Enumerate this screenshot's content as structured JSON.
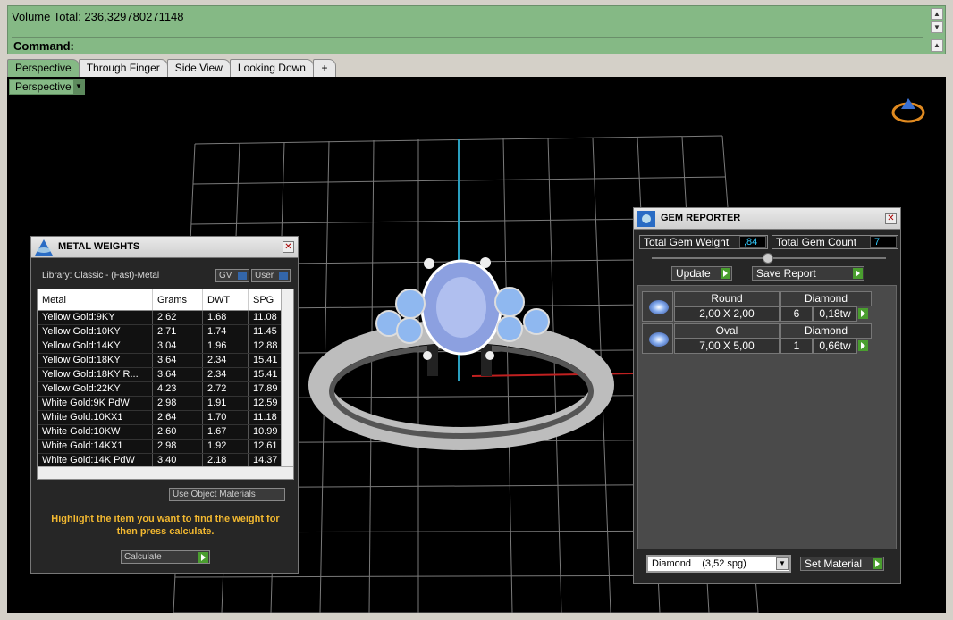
{
  "command_area": {
    "history": "Volume Total: 236,329780271148",
    "command_label": "Command:",
    "command_value": ""
  },
  "tabs": [
    "Perspective",
    "Through Finger",
    "Side View",
    "Looking Down"
  ],
  "tab_add": "+",
  "viewport": {
    "view_selector": "Perspective"
  },
  "metal_weights": {
    "title": "METAL WEIGHTS",
    "library_label": "Library: Classic - (Fast)-Metal",
    "gv_label": "GV",
    "user_label": "User",
    "columns": [
      "Metal",
      "Grams",
      "DWT",
      "SPG"
    ],
    "rows": [
      [
        "Yellow Gold:9KY",
        "2.62",
        "1.68",
        "11.08"
      ],
      [
        "Yellow Gold:10KY",
        "2.71",
        "1.74",
        "11.45"
      ],
      [
        "Yellow Gold:14KY",
        "3.04",
        "1.96",
        "12.88"
      ],
      [
        "Yellow Gold:18KY",
        "3.64",
        "2.34",
        "15.41"
      ],
      [
        "Yellow Gold:18KY R...",
        "3.64",
        "2.34",
        "15.41"
      ],
      [
        "Yellow Gold:22KY",
        "4.23",
        "2.72",
        "17.89"
      ],
      [
        "White Gold:9K PdW",
        "2.98",
        "1.91",
        "12.59"
      ],
      [
        "White Gold:10KX1",
        "2.64",
        "1.70",
        "11.18"
      ],
      [
        "White Gold:10KW",
        "2.60",
        "1.67",
        "10.99"
      ],
      [
        "White Gold:14KX1",
        "2.98",
        "1.92",
        "12.61"
      ],
      [
        "White Gold:14K PdW",
        "3.40",
        "2.18",
        "14.37"
      ]
    ],
    "use_object_materials": "Use Object Materials",
    "instruction": "Highlight the item you want to find the weight for then press calculate.",
    "calculate": "Calculate"
  },
  "gem_reporter": {
    "title": "GEM REPORTER",
    "total_weight_label": "Total Gem Weight",
    "total_weight_value": ",84",
    "total_count_label": "Total Gem Count",
    "total_count_value": "7",
    "update": "Update",
    "save_report": "Save Report",
    "gems": [
      {
        "shape": "Round",
        "material": "Diamond",
        "size": "2,00 X 2,00",
        "count": "6",
        "weight": "0,18tw"
      },
      {
        "shape": "Oval",
        "material": "Diamond",
        "size": "7,00 X 5,00",
        "count": "1",
        "weight": "0,66tw"
      }
    ],
    "material_select": "Diamond    (3,52 spg)",
    "set_material": "Set Material"
  }
}
